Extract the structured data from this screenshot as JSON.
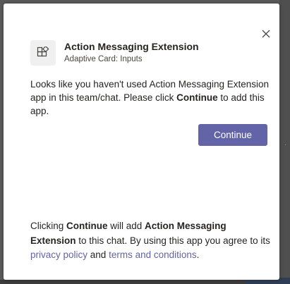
{
  "dialog": {
    "app_name": "Action Messaging Extension",
    "app_subtitle": "Adaptive Card: Inputs",
    "close_icon": "close-icon",
    "app_icon": "app-blocks-icon",
    "intro": {
      "text_before": "Looks like you haven't used Action Messaging Extension app in this team/chat. Please click ",
      "strong": "Continue",
      "text_after": " to add this app."
    },
    "continue_label": "Continue",
    "footer": {
      "part1": "Clicking ",
      "strong1": "Continue",
      "part2": " will add ",
      "strong2": "Action Messaging Extension",
      "part3": " to this chat. By using this app you agree to its ",
      "privacy_link": "privacy policy",
      "part4": " and ",
      "terms_link": "terms and conditions",
      "part5": "."
    }
  },
  "colors": {
    "accent": "#6264a7",
    "text": "#252423",
    "overlay": "#5b5b5b"
  }
}
